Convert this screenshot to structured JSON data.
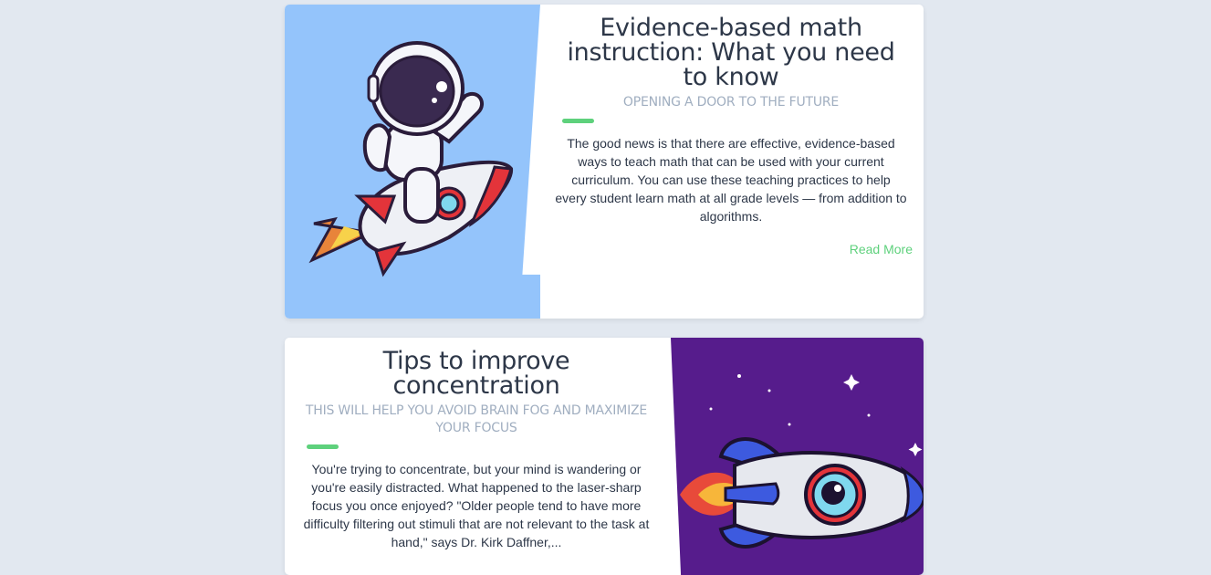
{
  "articles": [
    {
      "title": "Evidence-based math instruction: What you need to know",
      "subtitle": "OPENING A DOOR TO THE FUTURE",
      "body": "The good news is that there are effective, evidence-based ways to teach math that can be used with your current curriculum. You can use these teaching practices to help every student learn math at all grade levels — from addition to algorithms.",
      "link": "Read More",
      "image": "astronaut-riding-rocket-illustration"
    },
    {
      "title": "Tips to improve concentration",
      "subtitle": "THIS WILL HELP YOU AVOID BRAIN FOG AND MAXIMIZE YOUR FOCUS",
      "body": "You're trying to concentrate, but your mind is wandering or you're easily distracted. What happened to the laser-sharp focus you once enjoyed? \"Older people tend to have more difficulty filtering out stimuli that are not relevant to the task at hand,\" says Dr. Kirk Daffner,...",
      "image": "rocket-in-space-illustration"
    }
  ],
  "colors": {
    "page_background": "#e2e8f0",
    "accent": "#5ed17c",
    "card1_image_background": "#94c4fb",
    "card2_image_background": "#561c8c"
  }
}
